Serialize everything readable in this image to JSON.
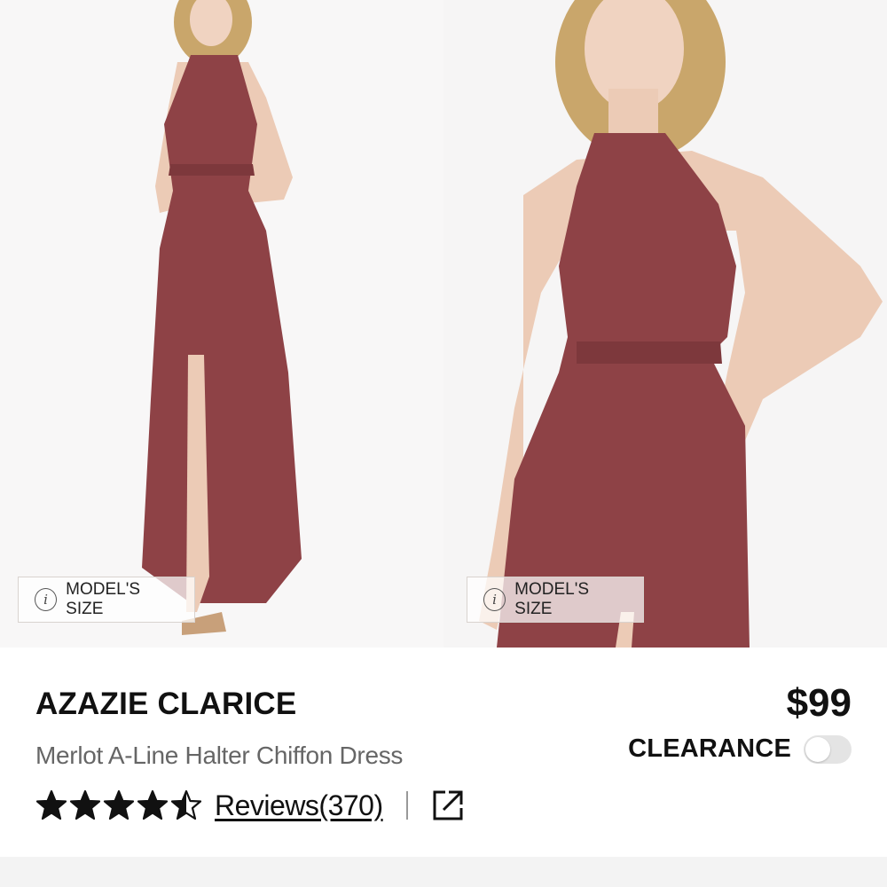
{
  "gallery": {
    "images": [
      {
        "alt": "Model full length in merlot halter dress",
        "badge_label": "MODEL'S SIZE"
      },
      {
        "alt": "Model close-up in merlot halter dress",
        "badge_label": "MODEL'S SIZE"
      }
    ],
    "info_icon_glyph": "i"
  },
  "product": {
    "brand": "AZAZIE CLARICE",
    "name": "Merlot A-Line Halter Chiffon Dress",
    "price": "$99",
    "clearance_label": "CLEARANCE",
    "clearance_on": false,
    "rating": 4.5,
    "rating_max": 5,
    "reviews_label": "Reviews(370)"
  },
  "icons": {
    "share": "share-icon",
    "info": "info-icon",
    "star": "star-icon"
  },
  "colors": {
    "dress": "#8e4246",
    "text": "#111111",
    "subtitle": "#666666",
    "toggle_off": "#e4e4e4"
  }
}
